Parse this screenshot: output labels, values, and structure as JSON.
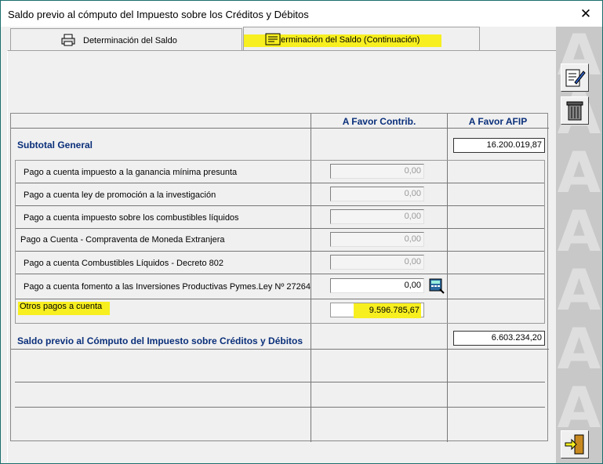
{
  "window": {
    "title": "Saldo previo al cómputo del Impuesto sobre los Créditos y Débitos",
    "close_glyph": "✕"
  },
  "tabs": [
    {
      "label": "Determinación del Saldo",
      "icon": "printer-icon"
    },
    {
      "label": "Determinación del Saldo (Continuación)",
      "icon": "receipt-icon"
    }
  ],
  "grid": {
    "col_favor_contrib": "A Favor Contrib.",
    "col_favor_afip": "A Favor AFIP",
    "subtotal_label": "Subtotal General",
    "subtotal_afip": "16.200.019,87",
    "rows": [
      {
        "label": "Pago a cuenta impuesto a la ganancia mínima presunta",
        "value": "0,00"
      },
      {
        "label": "Pago a cuenta ley de promoción a la investigación",
        "value": "0,00"
      },
      {
        "label": "Pago a cuenta impuesto sobre los combustibles líquidos",
        "value": "0,00"
      },
      {
        "label": " Pago a Cuenta - Compraventa de Moneda Extranjera",
        "value": "0,00"
      },
      {
        "label": "Pago a cuenta Combustibles Líquidos - Decreto 802",
        "value": "0,00"
      },
      {
        "label": "Pago a cuenta fomento a las Inversiones Productivas Pymes.Ley Nº 27264",
        "value": "0,00"
      },
      {
        "label": "Otros pagos a cuenta",
        "value": "9.596.785,67"
      }
    ],
    "saldo_label": "Saldo previo al Cómputo del Impuesto sobre Créditos y Débitos",
    "saldo_afip": "6.603.234,20"
  },
  "sidebar": {
    "buttons": [
      "edit-form-icon",
      "trash-icon",
      "exit-door-icon"
    ]
  },
  "colors": {
    "highlight": "#f7ef1f",
    "label_blue": "#0a2f7a",
    "sidebar_bg": "#c8c8c8"
  }
}
